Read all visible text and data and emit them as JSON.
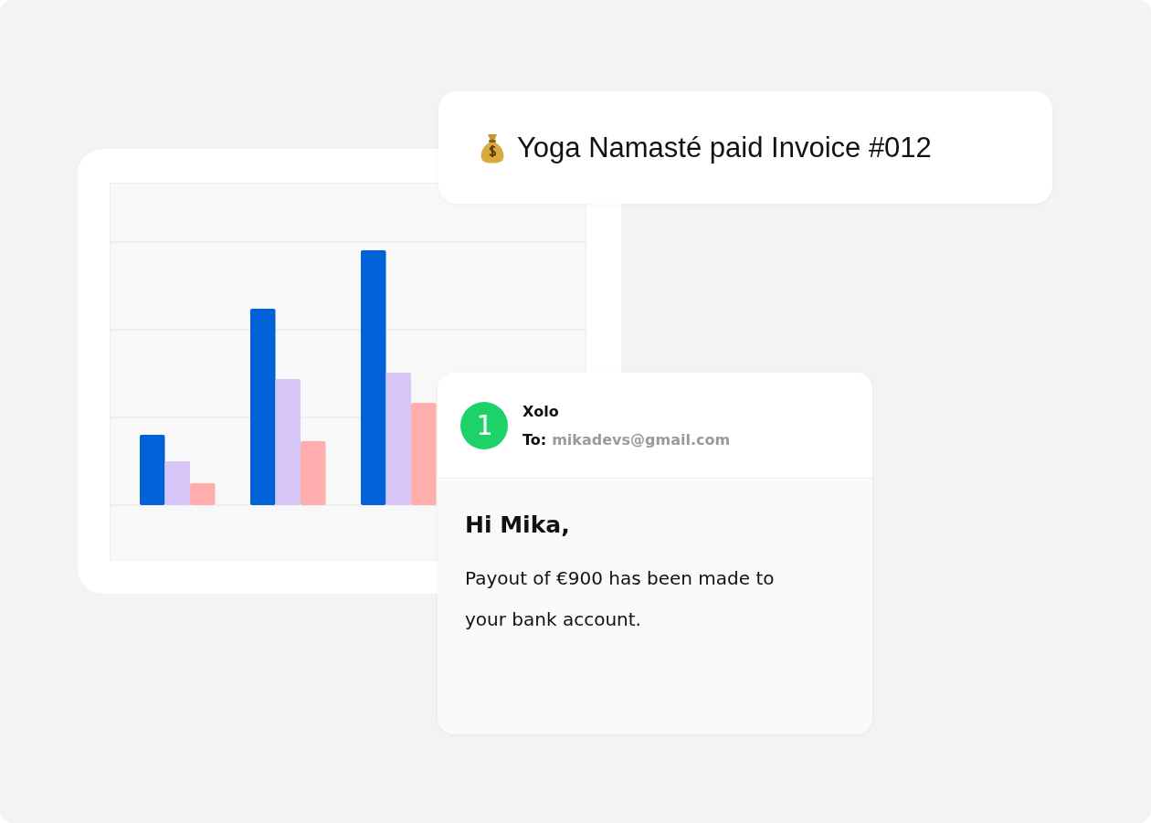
{
  "notification": {
    "text": "Yoga Namasté paid Invoice #012"
  },
  "email": {
    "logo_text": "1",
    "sender": "Xolo",
    "to_label": "To:",
    "to_address": "mikadevs@gmail.com",
    "greeting": "Hi Mika,",
    "body": "Payout of €900 has been made to your bank account."
  }
}
